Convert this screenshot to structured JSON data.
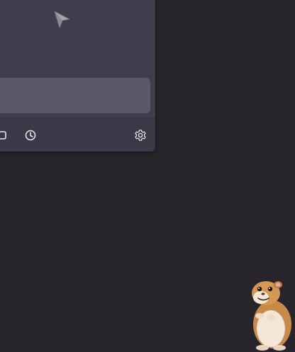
{
  "window": {
    "panel": {
      "input_placeholder": "",
      "footer": {
        "buttons": [
          {
            "name": "window-icon"
          },
          {
            "name": "history-icon"
          },
          {
            "name": "settings-icon"
          }
        ]
      }
    }
  },
  "colors": {
    "desktop_bg": "#27252b",
    "panel_bg": "#403e4e",
    "input_bg": "#5b5968",
    "footer_bg": "#3b3948",
    "icon_color": "#e8e7ee"
  },
  "decorations": {
    "pointer": "cursor-arrow-icon",
    "desktop_pet": "hamster-pet"
  }
}
